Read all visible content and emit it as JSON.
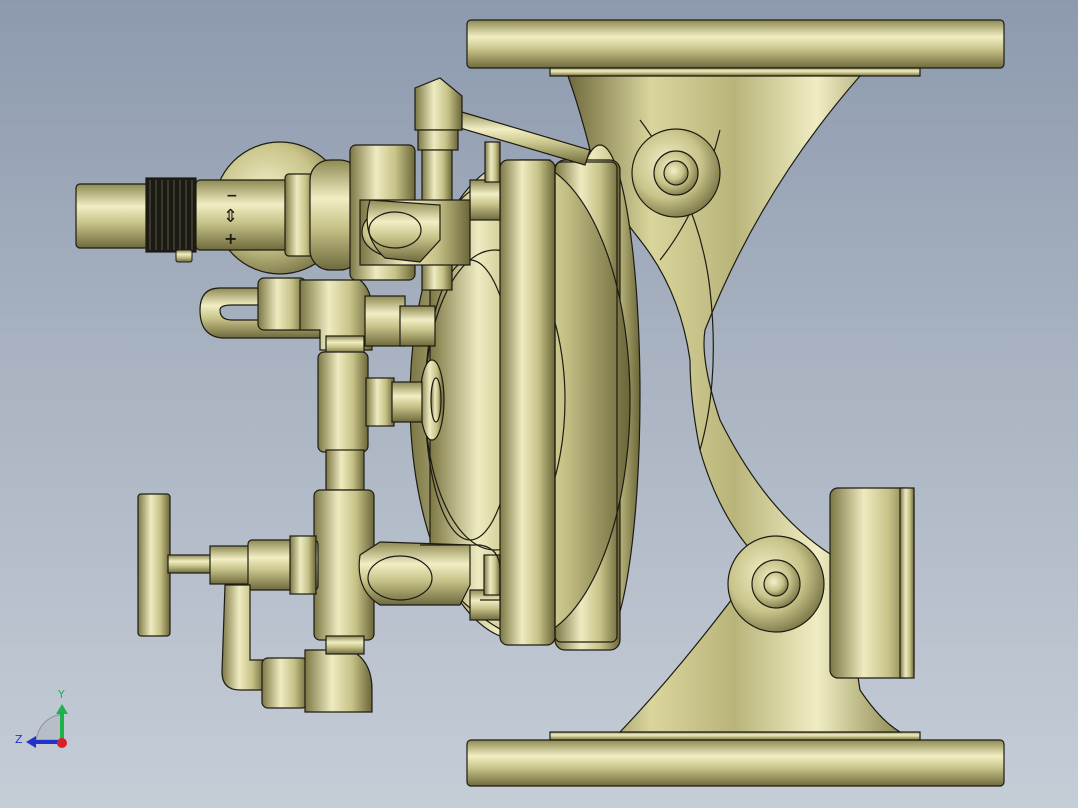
{
  "viewport": {
    "background_top": "#8d9aae",
    "background_bottom": "#c5cdd7"
  },
  "model": {
    "part_color": "#c8c48a",
    "highlight_color": "#f2efc6",
    "shadow_color": "#6f6a3d",
    "edge_color": "#1d1c12"
  },
  "adjuster_marks": {
    "minus": "−",
    "arrows": "⇕",
    "plus": "+"
  },
  "triad": {
    "y_label": "Y",
    "z_label": "Z",
    "y_color": "#1db34a",
    "z_color": "#2233cc",
    "x_color": "#d8202a"
  }
}
